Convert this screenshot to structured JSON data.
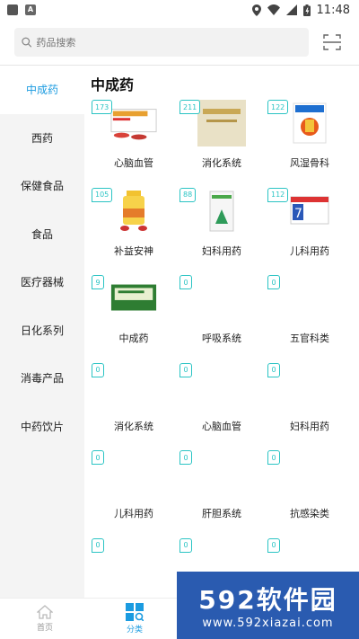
{
  "status_bar": {
    "time": "11:48"
  },
  "search": {
    "placeholder": "药品搜索"
  },
  "sidebar": {
    "items": [
      {
        "label": "中成药",
        "active": true
      },
      {
        "label": "西药"
      },
      {
        "label": "保健食品"
      },
      {
        "label": "食品"
      },
      {
        "label": "医疗器械"
      },
      {
        "label": "日化系列"
      },
      {
        "label": "消毒产品"
      },
      {
        "label": "中药饮片"
      }
    ]
  },
  "main": {
    "section_title": "中成药",
    "grid": [
      {
        "badge": "173",
        "label": "心脑血管",
        "image": "pill-box"
      },
      {
        "badge": "211",
        "label": "消化系统",
        "image": "tan-box"
      },
      {
        "badge": "122",
        "label": "风湿骨科",
        "image": "blue-bottle"
      },
      {
        "badge": "105",
        "label": "补益安神",
        "image": "yellow-bottle"
      },
      {
        "badge": "88",
        "label": "妇科用药",
        "image": "green-box"
      },
      {
        "badge": "112",
        "label": "儿科用药",
        "image": "blue-box"
      },
      {
        "badge": "9",
        "label": "中成药",
        "image": "green-pack"
      },
      {
        "badge": "0",
        "label": "呼吸系统",
        "image": ""
      },
      {
        "badge": "0",
        "label": "五官科类",
        "image": ""
      },
      {
        "badge": "0",
        "label": "消化系统",
        "image": ""
      },
      {
        "badge": "0",
        "label": "心脑血管",
        "image": ""
      },
      {
        "badge": "0",
        "label": "妇科用药",
        "image": ""
      },
      {
        "badge": "0",
        "label": "儿科用药",
        "image": ""
      },
      {
        "badge": "0",
        "label": "肝胆系统",
        "image": ""
      },
      {
        "badge": "0",
        "label": "抗感染类",
        "image": ""
      },
      {
        "badge": "0",
        "label": "",
        "image": ""
      },
      {
        "badge": "0",
        "label": "",
        "image": ""
      },
      {
        "badge": "0",
        "label": "",
        "image": ""
      }
    ]
  },
  "bottom_nav": [
    {
      "label": "首页",
      "icon": "home-icon"
    },
    {
      "label": "分类",
      "icon": "category-icon",
      "active": true
    }
  ],
  "watermark": {
    "big": "592软件园",
    "small": "www.592xiazai.com"
  },
  "colors": {
    "accent": "#1b9be0",
    "badge": "#2bc4c4"
  }
}
